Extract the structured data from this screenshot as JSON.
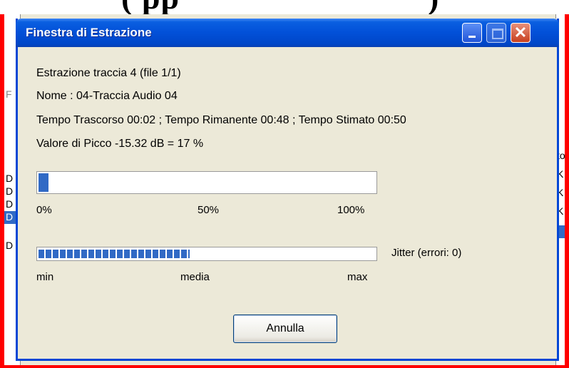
{
  "top_banner": {
    "text": "( pp",
    "right_text": ")"
  },
  "background_app": {
    "left_fragments": [
      "F",
      "D",
      "D",
      "D",
      "D",
      "D"
    ],
    "right_fragments": [
      "to",
      "K",
      "K",
      "K"
    ]
  },
  "dialog": {
    "title": "Finestra di Estrazione",
    "status_lines": {
      "track": "Estrazione traccia 4  (file 1/1)",
      "name": "Nome : 04-Traccia Audio 04",
      "times": "Tempo Trascorso 00:02 ; Tempo Rimanente 00:48 ; Tempo Stimato 00:50",
      "peak": "Valore di Picco -15.32 dB =  17 %"
    },
    "progress": {
      "value_percent": 3,
      "label_min": "0%",
      "label_mid": "50%",
      "label_max": "100%"
    },
    "jitter": {
      "value_fraction": 0.45,
      "label": "Jitter (errori: 0)",
      "label_min": "min",
      "label_mid": "media",
      "label_max": "max"
    },
    "cancel_label": "Annulla"
  },
  "colors": {
    "titlebar": "#0250d8",
    "progress": "#316ac5",
    "frame": "#ff0000"
  }
}
